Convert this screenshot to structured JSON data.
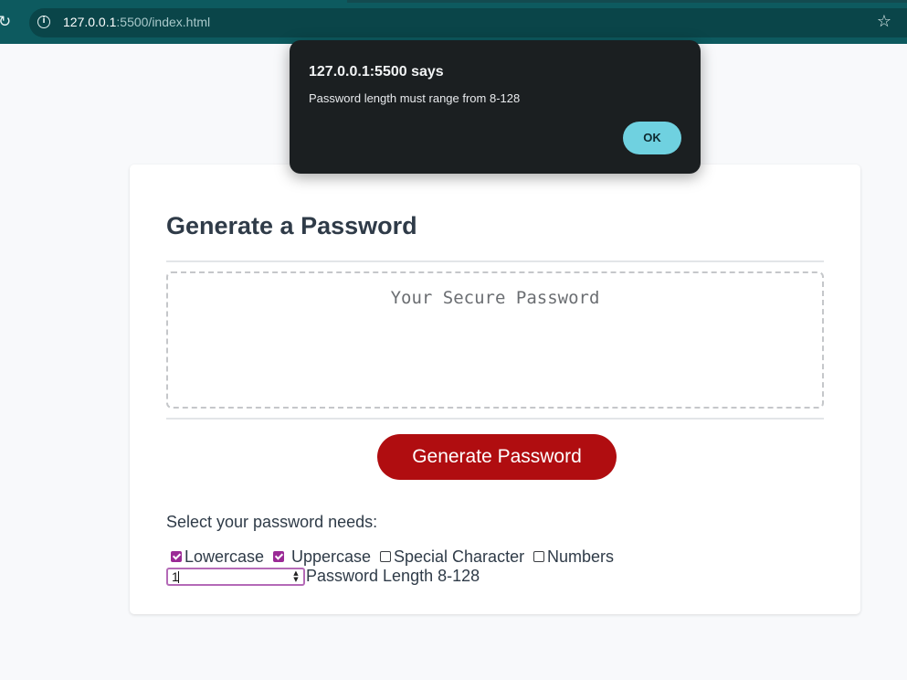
{
  "browser": {
    "reload_glyph": "↻",
    "info_glyph": "i",
    "url_host": "127.0.0.1",
    "url_rest": ":5500/index.html",
    "star_glyph": "☆",
    "colors": {
      "toolbar": "#0d5a5f",
      "omnibox": "#0a4549"
    }
  },
  "card": {
    "title": "Generate a Password",
    "password_placeholder": "Your Secure Password",
    "generate_label": "Generate Password",
    "needs_label": "Select your password needs:",
    "options": [
      {
        "label": "Lowercase",
        "checked": true
      },
      {
        "label": "Uppercase",
        "checked": true
      },
      {
        "label": "Special Character",
        "checked": false
      },
      {
        "label": "Numbers",
        "checked": false
      }
    ],
    "length_value": "1",
    "spinner_glyph": "▲▼",
    "length_label": "Password Length 8-128",
    "colors": {
      "generate_button": "#b00d10",
      "checkbox_checked": "#9b2a96",
      "text": "#2f3b48"
    }
  },
  "dialog": {
    "title": "127.0.0.1:5500 says",
    "message": "Password length must range from 8-128",
    "ok_label": "OK",
    "colors": {
      "background": "#1b1f21",
      "ok_button": "#6fd1e0"
    }
  }
}
